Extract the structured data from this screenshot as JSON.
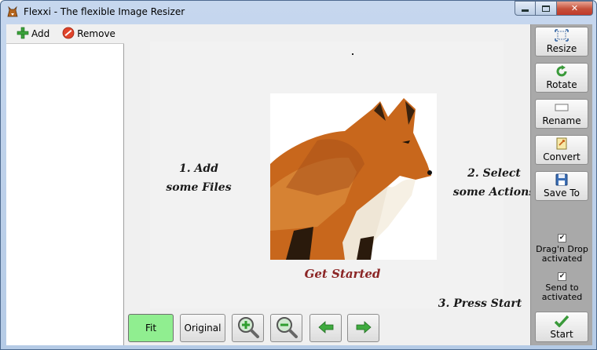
{
  "window": {
    "title": "Flexxi - The flexible Image Resizer",
    "minimize_icon": "minimize-icon",
    "maximize_icon": "maximize-icon",
    "close_icon": "close-icon"
  },
  "file_list": {
    "add_label": "Add",
    "remove_label": "Remove",
    "items": []
  },
  "preview": {
    "step1_line1": "1. Add",
    "step1_line2": "some Files",
    "step2_line1": "2. Select",
    "step2_line2": "some Actions",
    "step3": "3. Press Start",
    "get_started": "Get Started",
    "image_subject": "fox"
  },
  "nav": {
    "fit_label": "Fit",
    "original_label": "Original",
    "fit_active_color": "#90ee90"
  },
  "actions": {
    "resize_label": "Resize",
    "rotate_label": "Rotate",
    "rename_label": "Rename",
    "convert_label": "Convert",
    "saveto_label": "Save To",
    "start_label": "Start",
    "dragdrop_label_1": "Drag'n Drop",
    "dragdrop_label_2": "activated",
    "dragdrop_checked": true,
    "sendto_label_1": "Send to",
    "sendto_label_2": "activated",
    "sendto_checked": true
  }
}
